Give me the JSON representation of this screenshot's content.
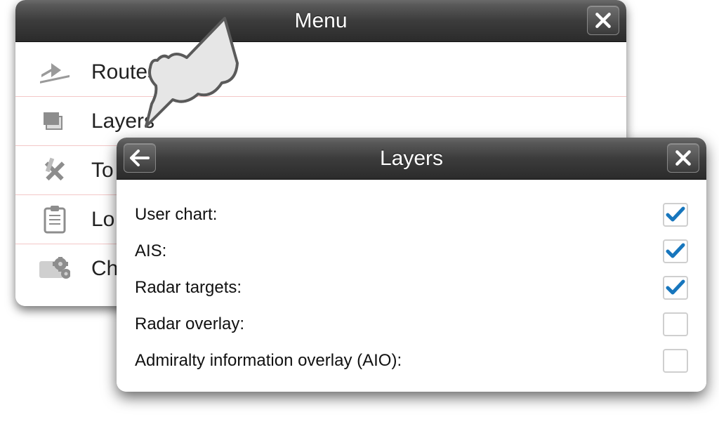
{
  "menu": {
    "title": "Menu",
    "items": [
      {
        "label": "Routes"
      },
      {
        "label": "Layers"
      },
      {
        "label": "To"
      },
      {
        "label": "Lo"
      },
      {
        "label": "Ch"
      }
    ]
  },
  "layers_panel": {
    "title": "Layers",
    "rows": [
      {
        "label": "User chart:",
        "checked": true
      },
      {
        "label": "AIS:",
        "checked": true
      },
      {
        "label": "Radar targets:",
        "checked": true
      },
      {
        "label": "Radar overlay:",
        "checked": false
      },
      {
        "label": "Admiralty information overlay (AIO):",
        "checked": false
      }
    ]
  },
  "colors": {
    "check": "#1776bd"
  }
}
